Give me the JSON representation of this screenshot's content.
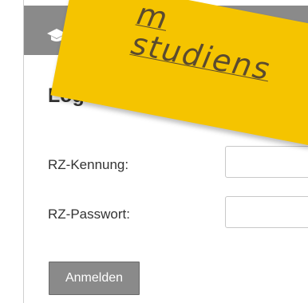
{
  "header": {
    "icon": "graduation-cap-icon"
  },
  "sticky_note": {
    "line1": "m",
    "line2": "studiens"
  },
  "login": {
    "title": "Login",
    "username_label": "RZ-Kennung:",
    "username_value": "",
    "password_label": "RZ-Passwort:",
    "password_value": "",
    "submit_label": "Anmelden"
  },
  "colors": {
    "header_bg": "#8a8a8a",
    "sticky_note": "#f5c400",
    "button_bg": "#8a8a8a",
    "text": "#333333"
  }
}
